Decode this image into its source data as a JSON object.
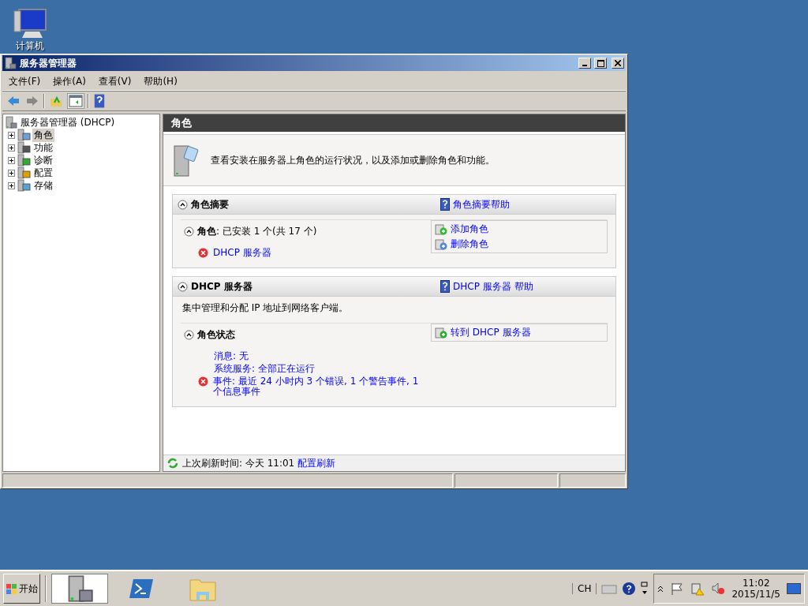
{
  "desktop_icons": [
    {
      "label": "计算机"
    }
  ],
  "window": {
    "title": "服务器管理器",
    "menu": [
      "文件(F)",
      "操作(A)",
      "查看(V)",
      "帮助(H)"
    ],
    "tree": {
      "root": "服务器管理器 (DHCP)",
      "items": [
        {
          "label": "角色",
          "selected": true,
          "kind": "roles"
        },
        {
          "label": "功能",
          "selected": false,
          "kind": "features"
        },
        {
          "label": "诊断",
          "selected": false,
          "kind": "diagnostics"
        },
        {
          "label": "配置",
          "selected": false,
          "kind": "configuration"
        },
        {
          "label": "存储",
          "selected": false,
          "kind": "storage"
        }
      ]
    },
    "pane": {
      "title": "角色",
      "intro": "查看安装在服务器上角色的运行状况，以及添加或删除角色和功能。",
      "sections": [
        {
          "title": "角色摘要",
          "expanded": true,
          "help": "角色摘要帮助",
          "subtitle": "**角色**: 已安装 1 个(共 17 个)",
          "sub_expanded": true,
          "actions": [
            {
              "label": "添加角色",
              "kind": "add"
            },
            {
              "label": "删除角色",
              "kind": "remove"
            }
          ],
          "lines": [
            {
              "text": "DHCP 服务器",
              "kind": "error"
            }
          ]
        },
        {
          "title": "DHCP 服务器",
          "expanded": true,
          "help": "DHCP 服务器 帮助",
          "description": "集中管理和分配 IP 地址到网络客户端。",
          "subtitle": "**角色状态**",
          "sub_expanded": true,
          "actions": [
            {
              "label": "转到 DHCP 服务器",
              "kind": "goto"
            }
          ],
          "lines": [
            {
              "text": "消息: 无",
              "kind": "none"
            },
            {
              "text": "系统服务: 全部正在运行",
              "kind": "none"
            },
            {
              "text": "事件: 最近 24 小时内 3 个错误, 1 个警告事件, 1 个信息事件",
              "kind": "error"
            }
          ]
        }
      ],
      "refresh": {
        "label": "上次刷新时间: 今天 11:01",
        "link": "配置刷新"
      }
    }
  },
  "taskbar": {
    "start": "开始",
    "apps": [
      {
        "kind": "server-manager",
        "selected": true
      },
      {
        "kind": "powershell",
        "selected": false
      },
      {
        "kind": "explorer",
        "selected": false
      }
    ],
    "language": "CH",
    "time": "11:02",
    "date": "2015/11/5"
  }
}
